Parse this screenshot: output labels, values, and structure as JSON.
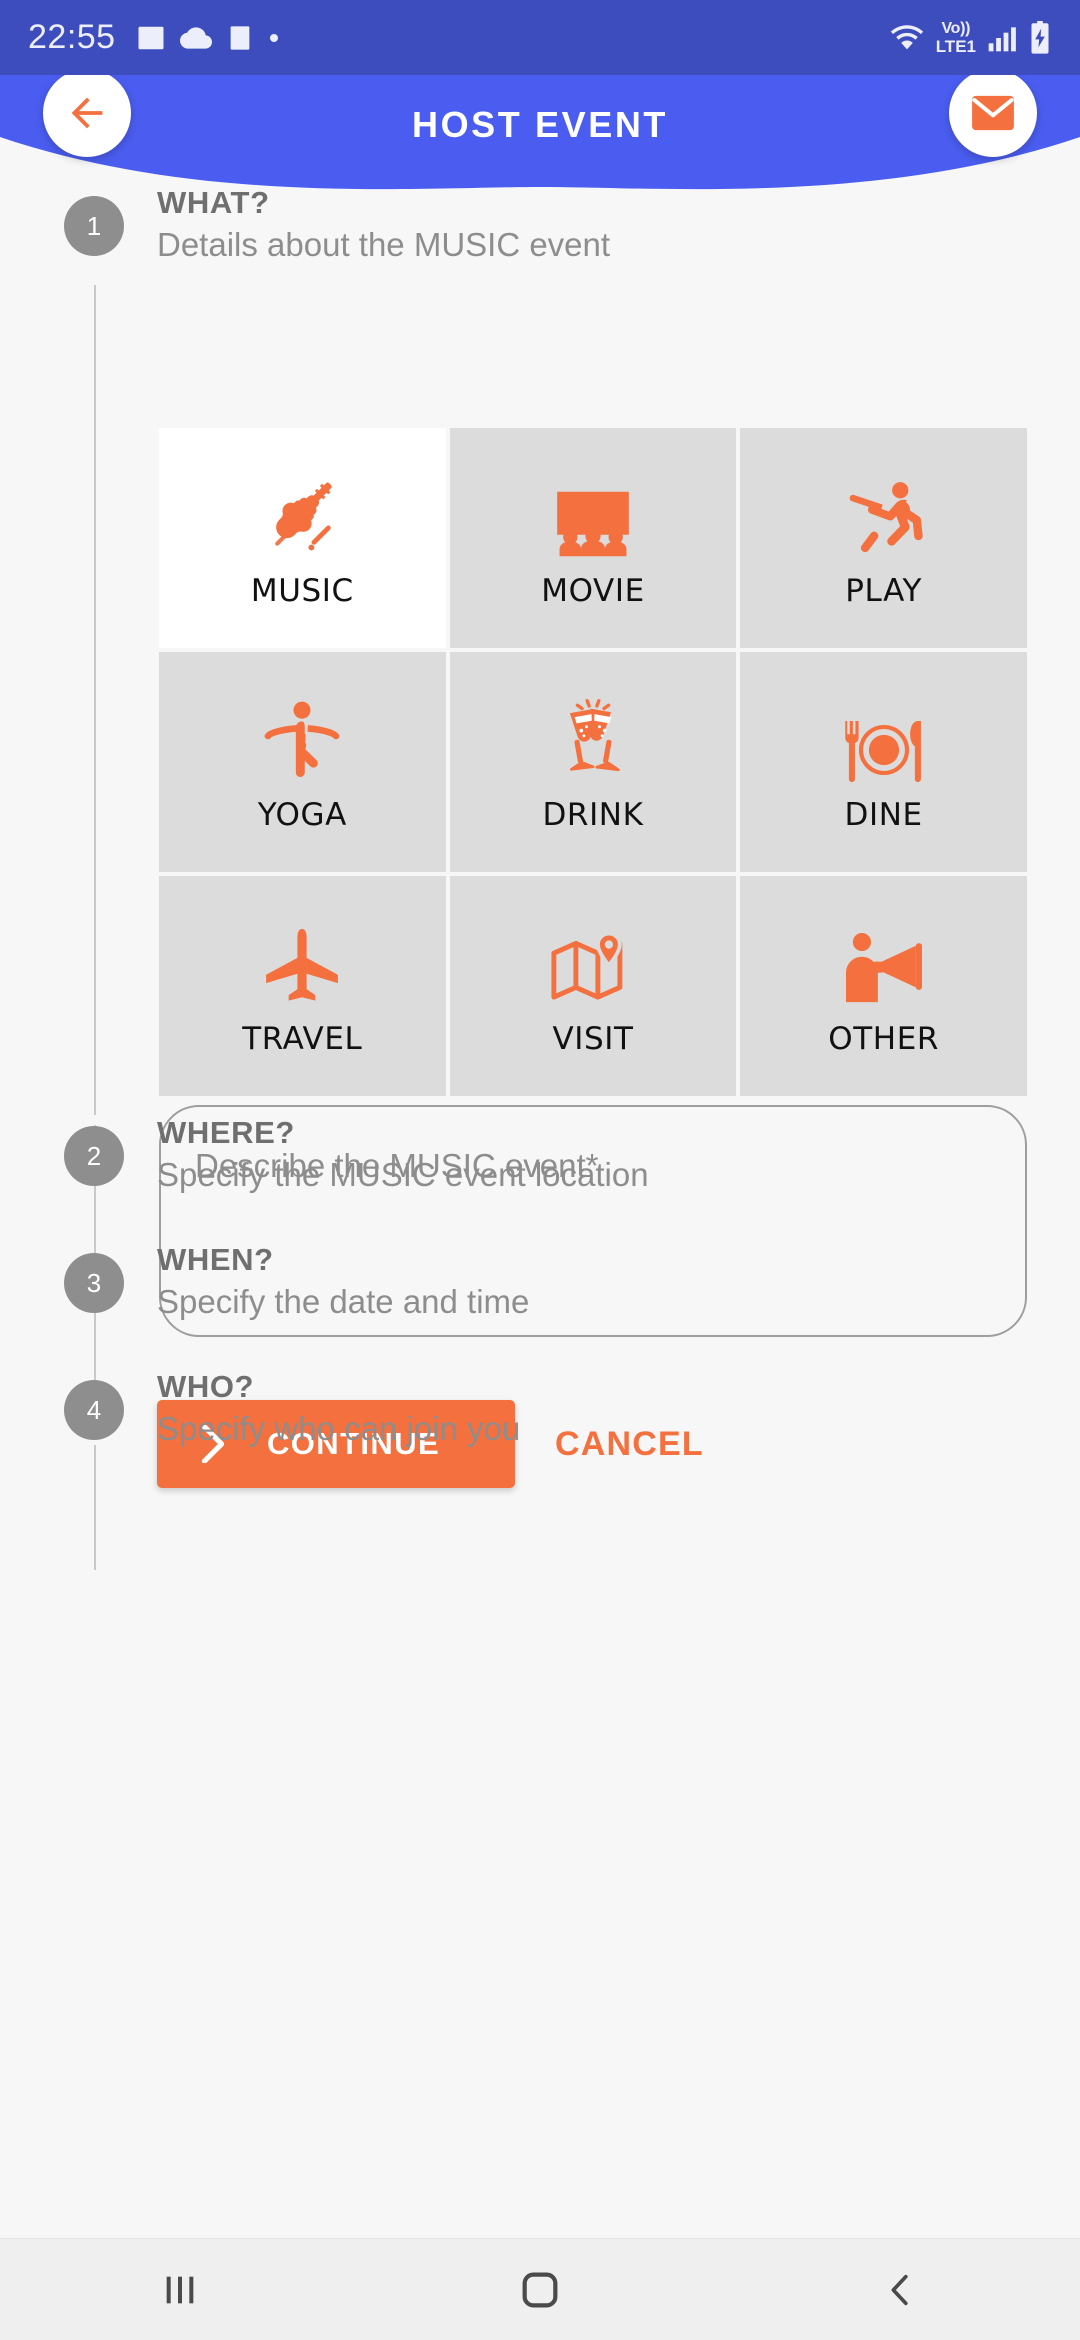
{
  "statusbar": {
    "clock": "22:55",
    "icons": [
      "image-icon",
      "cloud-icon",
      "notes-icon",
      "dot-icon"
    ],
    "network": {
      "line1": "Vo))",
      "line2": "LTE1"
    },
    "right_icons": [
      "wifi-icon",
      "volte-icon",
      "signal-icon",
      "battery-charging-icon"
    ]
  },
  "header": {
    "title": "HOST EVENT",
    "back_icon": "arrow-left-icon",
    "mail_icon": "envelope-icon",
    "bg_color": "#4a5df0",
    "statusbar_color": "#3d4dbe"
  },
  "theme": {
    "accent": "#f4703f",
    "page_bg": "#f7f7f7",
    "cell_bg": "#dcdcdc",
    "cell_selected_bg": "#ffffff",
    "step_badge_bg": "#8e8e8e"
  },
  "steps": [
    {
      "number": "1",
      "title": "WHAT?",
      "subtitle": "Details about the MUSIC event"
    },
    {
      "number": "2",
      "title": "WHERE?",
      "subtitle": "Specify the MUSIC event location"
    },
    {
      "number": "3",
      "title": "WHEN?",
      "subtitle": "Specify the date and time"
    },
    {
      "number": "4",
      "title": "WHO?",
      "subtitle": "Specify who can join you"
    }
  ],
  "categories": [
    {
      "label": "MUSIC",
      "icon": "violin-icon",
      "selected": true
    },
    {
      "label": "MOVIE",
      "icon": "cinema-icon",
      "selected": false
    },
    {
      "label": "PLAY",
      "icon": "batsman-icon",
      "selected": false
    },
    {
      "label": "YOGA",
      "icon": "yoga-pose-icon",
      "selected": false
    },
    {
      "label": "DRINK",
      "icon": "cheers-icon",
      "selected": false
    },
    {
      "label": "DINE",
      "icon": "dinner-icon",
      "selected": false
    },
    {
      "label": "TRAVEL",
      "icon": "airplane-icon",
      "selected": false
    },
    {
      "label": "VISIT",
      "icon": "map-pin-icon",
      "selected": false
    },
    {
      "label": "OTHER",
      "icon": "megaphone-icon",
      "selected": false
    }
  ],
  "describe": {
    "placeholder": "Describe the MUSIC event*",
    "value": ""
  },
  "actions": {
    "continue_label": "CONTINUE",
    "continue_icon": "chevron-right-icon",
    "cancel_label": "CANCEL"
  },
  "navbar": {
    "recents_icon": "recents-icon",
    "home_icon": "home-icon",
    "back_icon": "nav-back-icon"
  }
}
